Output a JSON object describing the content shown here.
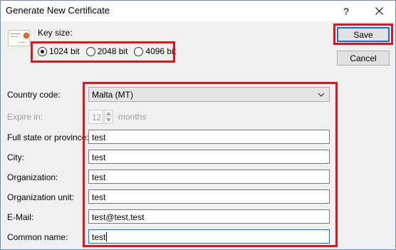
{
  "window": {
    "title": "Generate New Certificate",
    "help_glyph": "?"
  },
  "key_size": {
    "label": "Key size:",
    "options": [
      "1024 bit",
      "2048 bit",
      "4096 bit"
    ],
    "selected": "1024 bit"
  },
  "buttons": {
    "save": "Save",
    "cancel": "Cancel"
  },
  "form": {
    "country_code": {
      "label": "Country code:",
      "value": "Malta (MT)"
    },
    "expire_in": {
      "label": "Expire in:",
      "value": "12",
      "unit": "months",
      "enabled": false
    },
    "state": {
      "label": "Full state or province:",
      "value": "test"
    },
    "city": {
      "label": "City:",
      "value": "test"
    },
    "organization": {
      "label": "Organization:",
      "value": "test"
    },
    "org_unit": {
      "label": "Organization unit:",
      "value": "test"
    },
    "email": {
      "label": "E-Mail:",
      "value": "test@test.test"
    },
    "common_name": {
      "label": "Common name:",
      "value": "test"
    }
  },
  "colors": {
    "highlight_box": "#e0151e",
    "focus_border": "#0078d7"
  }
}
